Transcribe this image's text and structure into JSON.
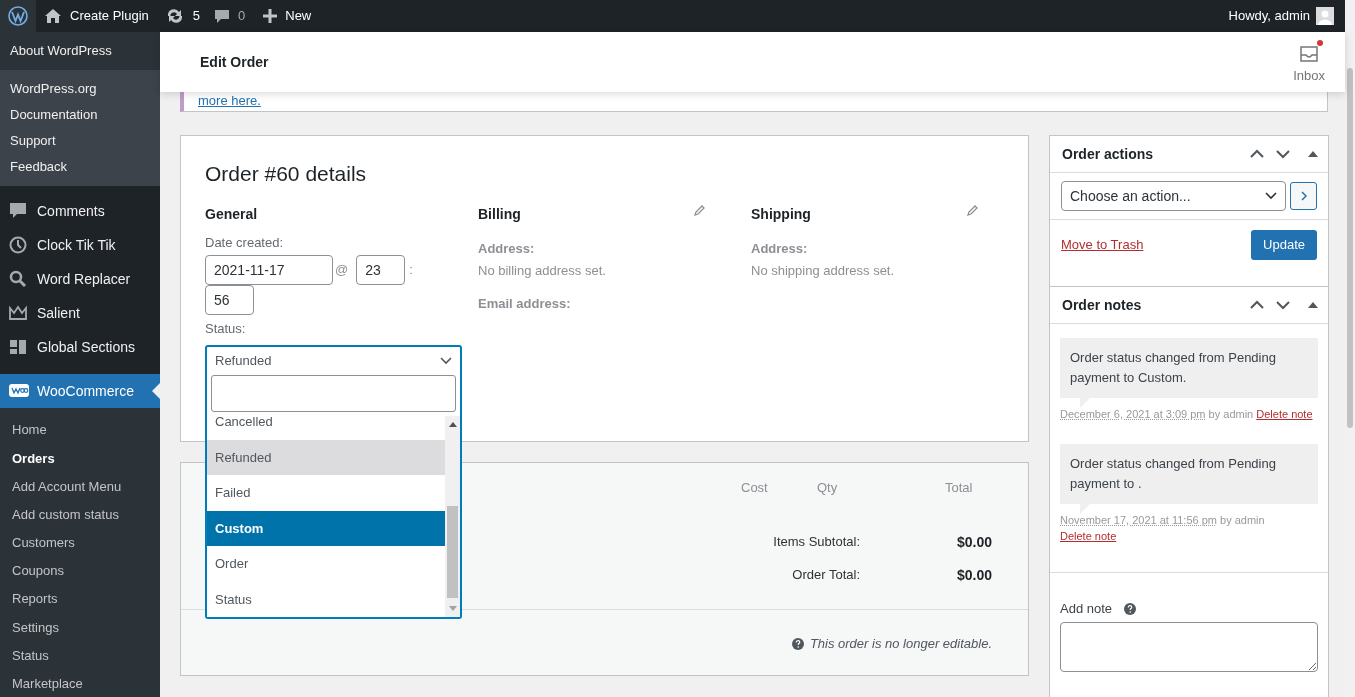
{
  "admin_bar": {
    "site": "Create Plugin",
    "updates": "5",
    "comments": "0",
    "new": "New",
    "greeting": "Howdy, admin"
  },
  "wp_flyout": {
    "about": "About WordPress",
    "links": [
      "WordPress.org",
      "Documentation",
      "Support",
      "Feedback"
    ]
  },
  "sidebar": {
    "items": [
      {
        "label": "Comments",
        "selected": false
      },
      {
        "label": "Clock Tik Tik",
        "selected": false
      },
      {
        "label": "Word Replacer",
        "selected": false
      },
      {
        "label": "Salient",
        "selected": false
      },
      {
        "label": "Global Sections",
        "selected": false
      },
      {
        "label": "WooCommerce",
        "selected": true
      }
    ],
    "submenu": [
      {
        "label": "Home",
        "selected": false
      },
      {
        "label": "Orders",
        "selected": true
      },
      {
        "label": "Add Account Menu",
        "selected": false
      },
      {
        "label": "Add custom status",
        "selected": false
      },
      {
        "label": "Customers",
        "selected": false
      },
      {
        "label": "Coupons",
        "selected": false
      },
      {
        "label": "Reports",
        "selected": false
      },
      {
        "label": "Settings",
        "selected": false
      },
      {
        "label": "Status",
        "selected": false
      },
      {
        "label": "Marketplace",
        "selected": false
      }
    ]
  },
  "header": {
    "title": "Edit Order",
    "inbox": "Inbox",
    "inbox_unread": true
  },
  "notice": {
    "link": "more here."
  },
  "order": {
    "title": "Order #60 details",
    "general": {
      "heading": "General",
      "date_label": "Date created:",
      "date": "2021-11-17",
      "at": "@",
      "hour": "23",
      "colon": ":",
      "minute": "56",
      "status_label": "Status:",
      "status_value": "Refunded"
    },
    "billing": {
      "heading": "Billing",
      "address_label": "Address:",
      "address_value": "No billing address set.",
      "email_label": "Email address:"
    },
    "shipping": {
      "heading": "Shipping",
      "address_label": "Address:",
      "address_value": "No shipping address set."
    }
  },
  "status_dropdown": {
    "options": [
      {
        "label": "Cancelled",
        "selected": false,
        "highlighted": false
      },
      {
        "label": "Refunded",
        "selected": false,
        "highlighted": true
      },
      {
        "label": "Failed",
        "selected": false,
        "highlighted": false
      },
      {
        "label": "Custom",
        "selected": true,
        "highlighted": false
      },
      {
        "label": "Order",
        "selected": false,
        "highlighted": false
      },
      {
        "label": "Status",
        "selected": false,
        "highlighted": false
      }
    ]
  },
  "items": {
    "columns": [
      "Cost",
      "Qty",
      "Total"
    ],
    "totals": [
      {
        "label": "Items Subtotal:",
        "value": "$0.00"
      },
      {
        "label": "Order Total:",
        "value": "$0.00"
      }
    ],
    "notice": "This order is no longer editable."
  },
  "order_actions": {
    "title": "Order actions",
    "select": "Choose an action...",
    "trash": "Move to Trash",
    "update": "Update"
  },
  "order_notes": {
    "title": "Order notes",
    "notes": [
      {
        "text": "Order status changed from Pending payment to Custom.",
        "date": "December 6, 2021 at 3:09 pm",
        "by": "by admin",
        "delete": "Delete note"
      },
      {
        "text": "Order status changed from Pending payment to .",
        "date": "November 17, 2021 at 11:56 pm",
        "by": "by admin",
        "delete": "Delete note"
      }
    ],
    "add_note_label": "Add note"
  }
}
